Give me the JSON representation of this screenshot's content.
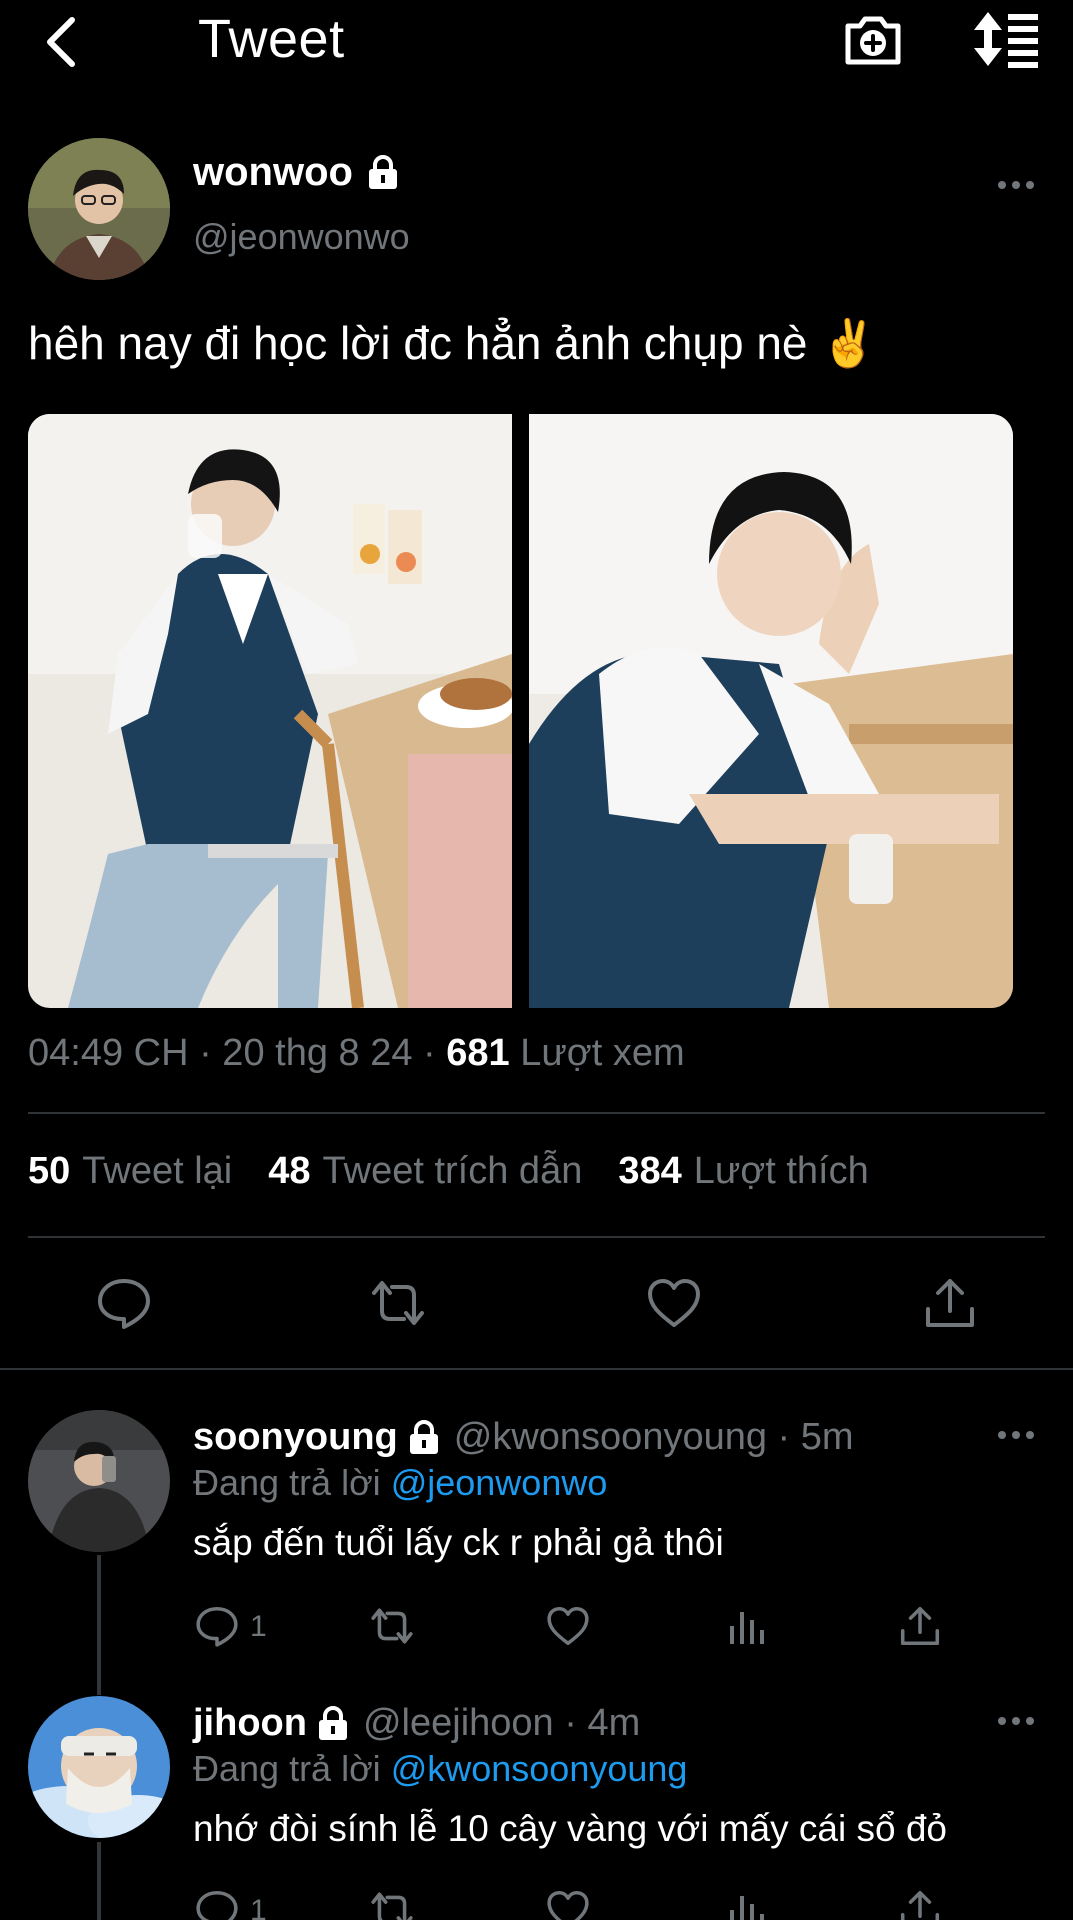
{
  "header": {
    "title": "Tweet",
    "back_icon": "chevron-left-icon",
    "camera_icon": "camera-plus-icon",
    "sort_icon": "sort-list-icon"
  },
  "tweet": {
    "name": "wonwoo",
    "handle": "@jeonwonwo",
    "text": "hêh nay đi học lời đc hẳn ảnh chụp nè ✌️",
    "emoji": "✌",
    "time": "04:49 CH · 20 thg 8 24 · ",
    "views_count": "681",
    "views_label": " Lượt xem",
    "stats": [
      {
        "count": "50",
        "label": "Tweet lại"
      },
      {
        "count": "48",
        "label": "Tweet trích dẫn"
      },
      {
        "count": "384",
        "label": "Lượt thích"
      }
    ]
  },
  "replies": [
    {
      "name": "soonyoung",
      "handle": "@kwonsoonyoung · 5m",
      "replying_prefix": "Đang trả lời ",
      "replying_to": "@jeonwonwo",
      "text": "sắp đến tuổi lấy ck r phải gả thôi",
      "reply_count": "1"
    },
    {
      "name": "jihoon",
      "handle": "@leejihoon · 4m",
      "replying_prefix": "Đang trả lời ",
      "replying_to": "@kwonsoonyoung",
      "text": "nhớ đòi sính lễ 10 cây vàng với mấy cái sổ đỏ",
      "reply_count": "1"
    }
  ],
  "colors": {
    "background": "#000000",
    "text": "#e7e9ea",
    "muted": "#71767b",
    "accent": "#1d9bf0",
    "divider": "#2f3336"
  }
}
